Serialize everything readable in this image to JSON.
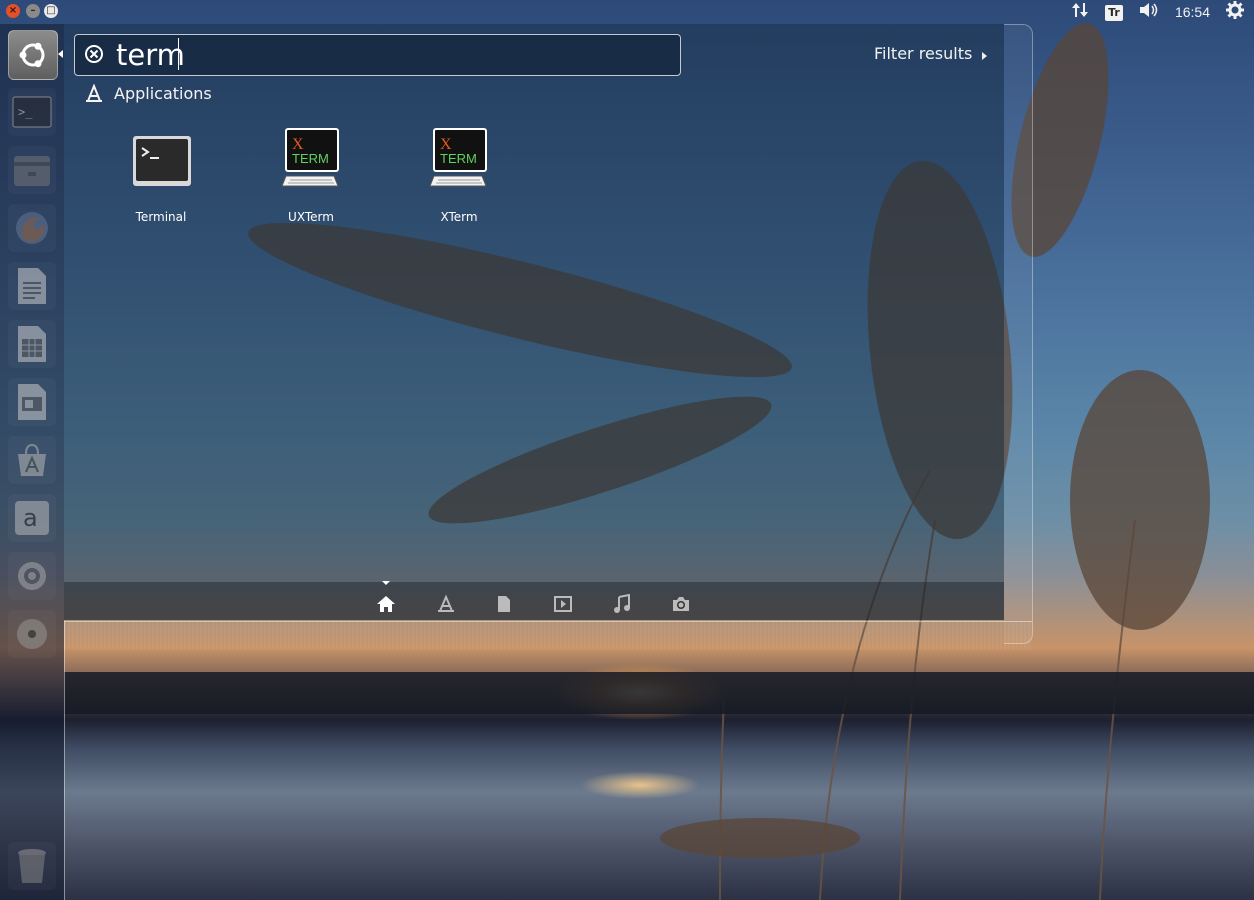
{
  "top_panel": {
    "window_buttons": {
      "close": "×",
      "minimize": "–",
      "maximize": "□"
    },
    "indicators": {
      "network_icon": "network-arrows-icon",
      "keyboard_layout": "Tr",
      "volume_icon": "speaker-icon",
      "clock": "16:54",
      "session_icon": "gear-icon"
    }
  },
  "launcher": {
    "items": [
      {
        "name": "dash-home",
        "icon": "ubuntu-logo-icon"
      },
      {
        "name": "terminal",
        "icon": "terminal-icon"
      },
      {
        "name": "files",
        "icon": "file-manager-icon"
      },
      {
        "name": "firefox",
        "icon": "firefox-icon"
      },
      {
        "name": "writer",
        "icon": "writer-icon"
      },
      {
        "name": "calc",
        "icon": "calc-icon"
      },
      {
        "name": "impress",
        "icon": "impress-icon"
      },
      {
        "name": "software-center",
        "icon": "software-center-icon"
      },
      {
        "name": "amazon",
        "icon": "amazon-icon"
      },
      {
        "name": "system-settings",
        "icon": "settings-icon"
      },
      {
        "name": "dvd",
        "icon": "disc-icon"
      },
      {
        "name": "trash",
        "icon": "trash-icon"
      }
    ]
  },
  "dash": {
    "search": {
      "value": "term",
      "clear_icon": "clear-icon"
    },
    "filter_results_label": "Filter results",
    "category": {
      "label": "Applications",
      "icon": "applications-icon"
    },
    "results": [
      {
        "label": "Terminal",
        "icon": "terminal-icon"
      },
      {
        "label": "UXTerm",
        "icon": "xterm-icon"
      },
      {
        "label": "XTerm",
        "icon": "xterm-icon"
      }
    ],
    "xterm_icon_text": {
      "x": "X",
      "term": "TERM"
    },
    "lenses": [
      {
        "name": "home",
        "icon": "home-icon",
        "selected": true
      },
      {
        "name": "applications",
        "icon": "applications-icon",
        "selected": false
      },
      {
        "name": "files",
        "icon": "file-icon",
        "selected": false
      },
      {
        "name": "video",
        "icon": "video-icon",
        "selected": false
      },
      {
        "name": "music",
        "icon": "music-icon",
        "selected": false
      },
      {
        "name": "photos",
        "icon": "camera-icon",
        "selected": false
      }
    ]
  },
  "colors": {
    "panel_text": "#f2f2f2",
    "close_button": "#e2512c",
    "launcher_bg": "#141c30"
  }
}
